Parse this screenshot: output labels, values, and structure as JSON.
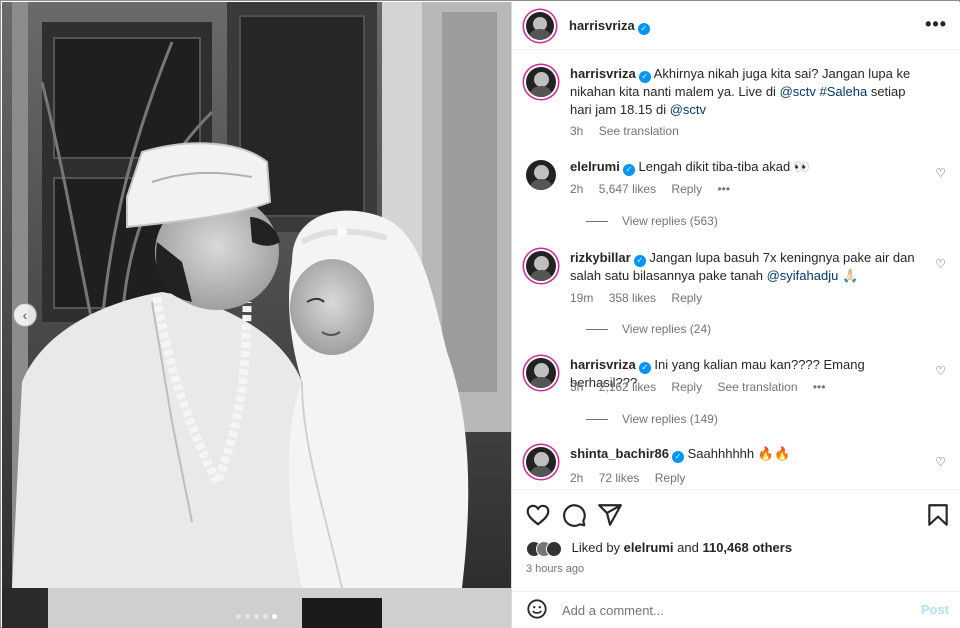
{
  "post": {
    "author": "harrisvriza",
    "more_label": "•••",
    "carousel": {
      "dot_count": 5,
      "active_index": 4,
      "prev_label": "‹"
    }
  },
  "caption": {
    "username": "harrisvriza",
    "text_parts": [
      {
        "text": "Akhirnya nikah juga kita sai? Jangan lupa ke nikahan kita nanti malem ya. Live di ",
        "type": "text"
      },
      {
        "text": "@sctv",
        "type": "link"
      },
      {
        "text": " ",
        "type": "text"
      },
      {
        "text": "#Saleha",
        "type": "link"
      },
      {
        "text": " setiap hari jam 18.15 di ",
        "type": "text"
      },
      {
        "text": "@sctv",
        "type": "link"
      }
    ],
    "time": "3h",
    "see_translation": "See translation"
  },
  "comments": [
    {
      "username": "elelrumi",
      "text": "Lengah dikit tiba-tiba akad",
      "emoji": "👀",
      "time": "2h",
      "likes": "5,647 likes",
      "reply": "Reply",
      "more": "•••",
      "view_replies": "View replies (563)"
    },
    {
      "username": "rizkybillar",
      "text": "Jangan lupa basuh 7x keningnya pake air dan salah satu bilasannya pake tanah ",
      "mention": "@syifahadju",
      "emoji": "🙏🏻",
      "time": "19m",
      "likes": "358 likes",
      "reply": "Reply",
      "view_replies": "View replies (24)"
    },
    {
      "username": "harrisvriza",
      "text": "Ini yang kalian mau kan???? Emang berhasil???",
      "time": "3h",
      "likes": "2,162 likes",
      "reply": "Reply",
      "see_translation": "See translation",
      "more": "•••",
      "view_replies": "View replies (149)"
    },
    {
      "username": "shinta_bachir86",
      "text": "Saahhhhhh",
      "emoji": "🔥🔥",
      "time": "2h",
      "likes": "72 likes",
      "reply": "Reply"
    }
  ],
  "likes": {
    "prefix": "Liked by ",
    "user": "elelrumi",
    "middle": " and ",
    "count": "110,468 others"
  },
  "time_ago": "3 hours ago",
  "comment_box": {
    "placeholder": "Add a comment...",
    "post_label": "Post"
  },
  "icons": {
    "like": "heart-icon",
    "comment": "comment-icon",
    "share": "share-icon",
    "save": "bookmark-icon",
    "emoji": "smiley-icon"
  }
}
